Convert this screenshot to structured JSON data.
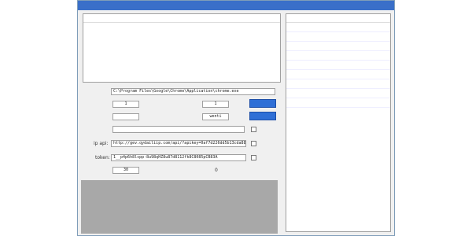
{
  "window": {
    "title": ""
  },
  "left_table": {
    "columns": [
      "",
      "",
      ""
    ]
  },
  "right_table": {
    "columns": [
      "",
      ""
    ]
  },
  "form": {
    "browser_path_label": "",
    "browser_path_value": "C:\\Program Files\\Google\\Chrome\\Application\\chrome.exe",
    "thread_count_label": "",
    "thread_count_value": "1",
    "thread_interval_label": "",
    "thread_interval_value": "1",
    "start_button": "",
    "file_a_label": "",
    "file_a_value": "",
    "file_b_label": "",
    "file_b_value": "wenti",
    "fetch_address_button": "",
    "suffix_label": "",
    "suffix_value": "",
    "hide_run_label": "",
    "ip_api_label": "ip api:",
    "ip_api_value": "http://gev.qydailiip.com/api/?apikey=0af7d226dd5b13cda886d85",
    "use_api_label": "",
    "token_label": "token:",
    "token_value": "1__p4p6h8lspp-8u98qHZ8u87d8112fk8C8085pCB83A",
    "use_proxy_label": "",
    "count_label": "",
    "count_value": "30",
    "completed_label": "",
    "completed_count": "0"
  },
  "log": {
    "lines": [
      "",
      "",
      "",
      "",
      "",
      "",
      ""
    ]
  }
}
